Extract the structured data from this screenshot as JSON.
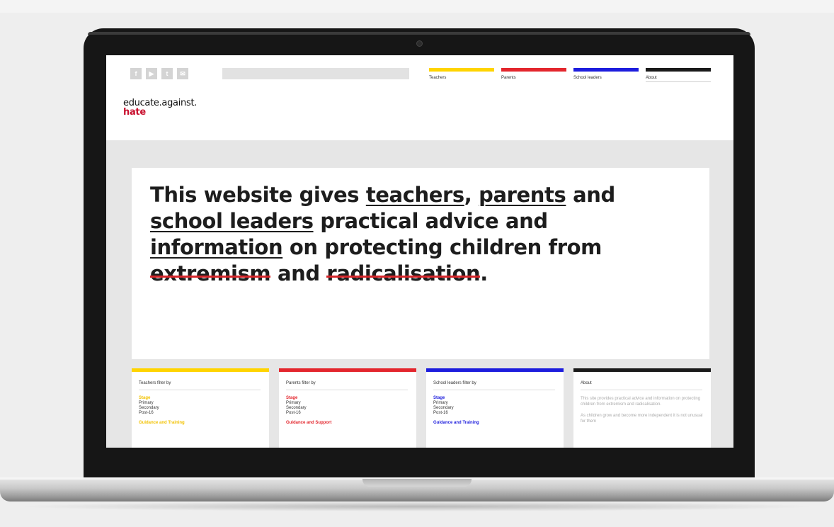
{
  "brand": {
    "line1": "educate.against.",
    "line2": "hate"
  },
  "nav": [
    {
      "label": "Teachers",
      "color": "#ffd400"
    },
    {
      "label": "Parents",
      "color": "#e3262d"
    },
    {
      "label": "School leaders",
      "color": "#1d1ddd"
    },
    {
      "label": "About",
      "color": "#1a1a1a"
    }
  ],
  "social_icons": [
    "facebook-icon",
    "youtube-icon",
    "twitter-icon",
    "email-icon"
  ],
  "hero": {
    "t1": "This website gives ",
    "teachers": "teachers",
    "t2": ", ",
    "parents": "parents",
    "t3": " and",
    "school_leaders": "school leaders",
    "t4": " practical advice and",
    "information": "information",
    "t5": " on protecting children from",
    "extremism": "extremism",
    "t6": " and ",
    "radicalisation": "radicalisation",
    "t7": "."
  },
  "cards": {
    "teachers": {
      "title": "Teachers filter by",
      "section1": "Stage",
      "items": [
        "Primary",
        "Secondary",
        "Post-16"
      ],
      "section2": "Guidance and Training"
    },
    "parents": {
      "title": "Parents filter by",
      "section1": "Stage",
      "items": [
        "Primary",
        "Secondary",
        "Post-16"
      ],
      "section2": "Guidance and Support"
    },
    "school_leaders": {
      "title": "School leaders filter by",
      "section1": "Stage",
      "items": [
        "Primary",
        "Secondary",
        "Post-16"
      ],
      "section2": "Guidance and Training"
    },
    "about": {
      "title": "About",
      "para1": "This site provides practical advice and information on protecting children from extremism and radicalisation.",
      "para2": "As children grow and become more independent it is not unusual for them"
    }
  },
  "colors": {
    "teachers": "#ffd400",
    "parents": "#e3262d",
    "school_leaders": "#1d1ddd",
    "about": "#1a1a1a",
    "strike": "#d6262b",
    "brand_accent": "#c8102e"
  }
}
